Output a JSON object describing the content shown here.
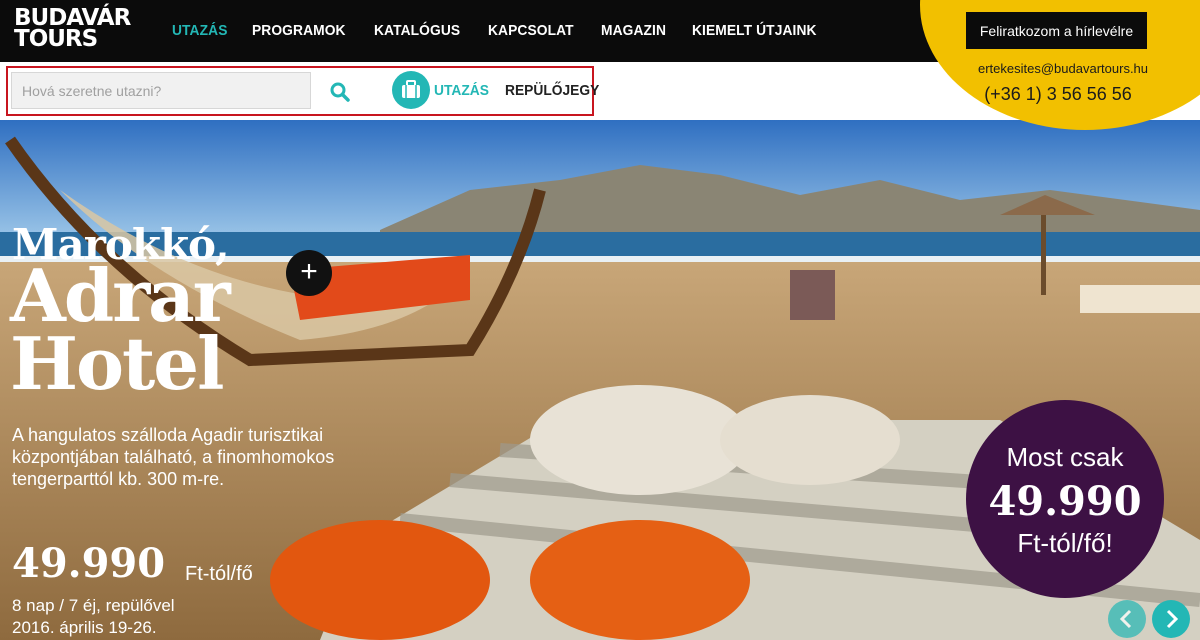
{
  "header": {
    "logo": {
      "line1": "BUDAVÁR",
      "line2": "TOURS"
    },
    "nav": [
      "UTAZÁS",
      "PROGRAMOK",
      "KATALÓGUS",
      "KAPCSOLAT",
      "MAGAZIN",
      "KIEMELT ÚTJAINK"
    ],
    "subscribe_label": "Feliratkozom a hírlevélre",
    "email": "ertekesites@budavartours.hu",
    "phone": "(+36 1) 3 56 56 56"
  },
  "search": {
    "placeholder": "Hová szeretne utazni?",
    "mode_travel": "UTAZÁS",
    "mode_flight": "REPÜLŐJEGY"
  },
  "hero": {
    "title_line1": "Marokkó,",
    "title_line2": "Adrar",
    "title_line3": "Hotel",
    "description": "A hangulatos szálloda Agadir turisztikai központjában található, a finomhomokos tengerparttól kb. 300 m-re.",
    "price": "49.990",
    "price_unit": "Ft-tól/fő",
    "duration": "8 nap / 7 éj, repülővel",
    "date": "2016. április 19-26.",
    "promo_line1": "Most csak",
    "promo_price": "49.990",
    "promo_line3": "Ft-tól/fő!"
  },
  "colors": {
    "accent": "#23b7b5",
    "yellow": "#f2c000",
    "promo": "#3d1144",
    "highlight": "#c8151f"
  }
}
